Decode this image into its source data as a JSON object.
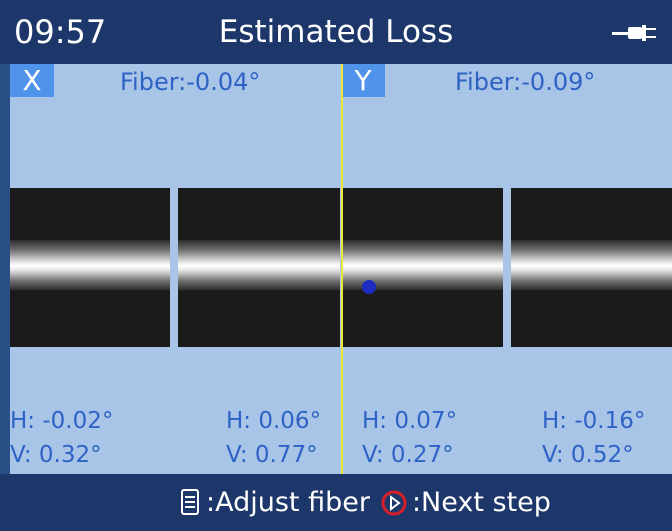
{
  "header": {
    "time": "09:57",
    "title": "Estimated Loss"
  },
  "fiber": {
    "x": {
      "label": "X",
      "angle": "Fiber:-0.04°"
    },
    "y": {
      "label": "Y",
      "angle": "Fiber:-0.09°"
    }
  },
  "angles": {
    "left": {
      "h1": "H: -0.02°",
      "v1": "V: 0.32°",
      "h2": "H: 0.06°",
      "v2": "V: 0.77°"
    },
    "right": {
      "h1": "H: 0.07°",
      "v1": "V: 0.27°",
      "h2": "H: -0.16°",
      "v2": "V: 0.52°"
    }
  },
  "footer": {
    "adjust_label": ":Adjust fiber",
    "next_label": ":Next step"
  },
  "icons": {
    "power": "power-plug-icon",
    "menu": "menu-icon",
    "next": "next-step-icon"
  },
  "colors": {
    "header": "#1d376a",
    "panel": "#a8c5e8",
    "tag": "#4f93ea",
    "text_blue": "#2f62c5",
    "divider": "#ebe735"
  }
}
